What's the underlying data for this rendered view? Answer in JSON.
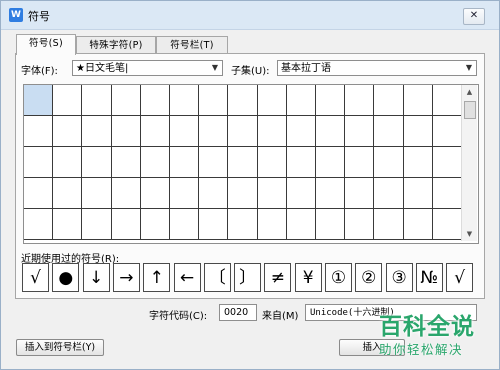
{
  "window": {
    "title": "符号",
    "app_icon": "W",
    "close_glyph": "✕"
  },
  "tabs": [
    {
      "label": "符号(S)",
      "active": true
    },
    {
      "label": "特殊字符(P)",
      "active": false
    },
    {
      "label": "符号栏(T)",
      "active": false
    }
  ],
  "font": {
    "label": "字体(F):",
    "value": "★日文毛笔|"
  },
  "subset": {
    "label": "子集(U):",
    "value": "基本拉丁语"
  },
  "grid": {
    "selected_index": 0
  },
  "recent": {
    "label": "近期使用过的符号(R):",
    "symbols": [
      "√",
      "●",
      "↓",
      "→",
      "↑",
      "←",
      "〔",
      "〕",
      "≠",
      "¥",
      "①",
      "②",
      "③",
      "№",
      "√"
    ]
  },
  "char_code": {
    "label": "字符代码(C):",
    "value": "0020"
  },
  "source": {
    "label": "来自(M)",
    "value": "Unicode(十六进制)"
  },
  "buttons": {
    "insert_to_bar": "插入到符号栏(Y)",
    "insert": "插入"
  },
  "watermark": {
    "main": "百科全说",
    "sub": "助你轻松解决"
  },
  "colors": {
    "watermark": "#2aa66c",
    "selected_cell": "#c9ddf2",
    "titlebar": "#dbe8f5"
  }
}
